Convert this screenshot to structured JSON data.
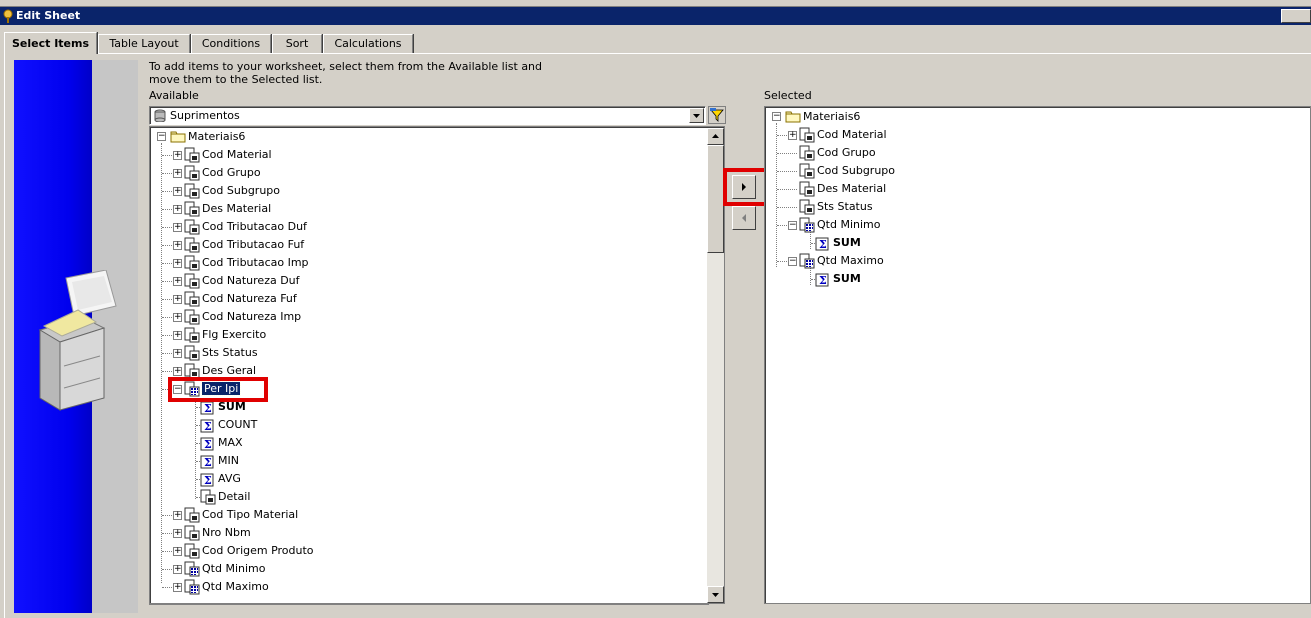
{
  "window": {
    "title": "Edit Sheet"
  },
  "tabs": [
    {
      "label": "Select Items",
      "active": true
    },
    {
      "label": "Table Layout",
      "active": false
    },
    {
      "label": "Conditions",
      "active": false
    },
    {
      "label": "Sort",
      "active": false
    },
    {
      "label": "Calculations",
      "active": false
    }
  ],
  "instructions": "To add items to your worksheet, select them from the Available list and move them to the Selected list.",
  "available": {
    "label": "Available",
    "business_area": "Suprimentos",
    "root": "Materiais6",
    "items": [
      {
        "text": "Cod Material",
        "icon": "item-icon",
        "expander": "plus"
      },
      {
        "text": "Cod Grupo",
        "icon": "item-icon",
        "expander": "plus"
      },
      {
        "text": "Cod Subgrupo",
        "icon": "item-icon",
        "expander": "plus"
      },
      {
        "text": "Des Material",
        "icon": "item-icon",
        "expander": "plus"
      },
      {
        "text": "Cod Tributacao Duf",
        "icon": "item-icon",
        "expander": "plus"
      },
      {
        "text": "Cod Tributacao Fuf",
        "icon": "item-icon",
        "expander": "plus"
      },
      {
        "text": "Cod Tributacao Imp",
        "icon": "item-icon",
        "expander": "plus"
      },
      {
        "text": "Cod Natureza Duf",
        "icon": "item-icon",
        "expander": "plus"
      },
      {
        "text": "Cod Natureza Fuf",
        "icon": "item-icon",
        "expander": "plus"
      },
      {
        "text": "Cod Natureza Imp",
        "icon": "item-icon",
        "expander": "plus"
      },
      {
        "text": "Flg Exercito",
        "icon": "item-icon",
        "expander": "plus"
      },
      {
        "text": "Sts Status",
        "icon": "item-icon",
        "expander": "plus"
      },
      {
        "text": "Des Geral",
        "icon": "item-icon",
        "expander": "plus"
      },
      {
        "text": "Per Ipi",
        "icon": "numeric-item-icon",
        "expander": "minus",
        "selected": true
      },
      {
        "text": "SUM",
        "icon": "sigma-icon",
        "child": true,
        "bold": true
      },
      {
        "text": "COUNT",
        "icon": "sigma-icon",
        "child": true
      },
      {
        "text": "MAX",
        "icon": "sigma-icon",
        "child": true
      },
      {
        "text": "MIN",
        "icon": "sigma-icon",
        "child": true
      },
      {
        "text": "AVG",
        "icon": "sigma-icon",
        "child": true
      },
      {
        "text": "Detail",
        "icon": "item-icon",
        "child": true
      },
      {
        "text": "Cod Tipo Material",
        "icon": "item-icon",
        "expander": "plus"
      },
      {
        "text": "Nro Nbm",
        "icon": "item-icon",
        "expander": "plus"
      },
      {
        "text": "Cod Origem Produto",
        "icon": "item-icon",
        "expander": "plus"
      },
      {
        "text": "Qtd Minimo",
        "icon": "numeric-item-icon",
        "expander": "plus"
      },
      {
        "text": "Qtd Maximo",
        "icon": "numeric-item-icon",
        "expander": "plus"
      }
    ]
  },
  "selected": {
    "label": "Selected",
    "root": "Materiais6",
    "items": [
      {
        "text": "Cod Material",
        "icon": "item-icon",
        "expander": "plus"
      },
      {
        "text": "Cod Grupo",
        "icon": "item-icon"
      },
      {
        "text": "Cod Subgrupo",
        "icon": "item-icon"
      },
      {
        "text": "Des Material",
        "icon": "item-icon"
      },
      {
        "text": "Sts Status",
        "icon": "item-icon"
      },
      {
        "text": "Qtd Minimo",
        "icon": "numeric-item-icon",
        "expander": "minus"
      },
      {
        "text": "SUM",
        "icon": "sigma-icon",
        "child": true,
        "bold": true
      },
      {
        "text": "Qtd Maximo",
        "icon": "numeric-item-icon",
        "expander": "minus"
      },
      {
        "text": "SUM",
        "icon": "sigma-icon",
        "child": true,
        "bold": true
      }
    ]
  },
  "colors": {
    "titlebar": "#0a246a",
    "highlight_box": "#e00000",
    "selection": "#0a246a"
  }
}
